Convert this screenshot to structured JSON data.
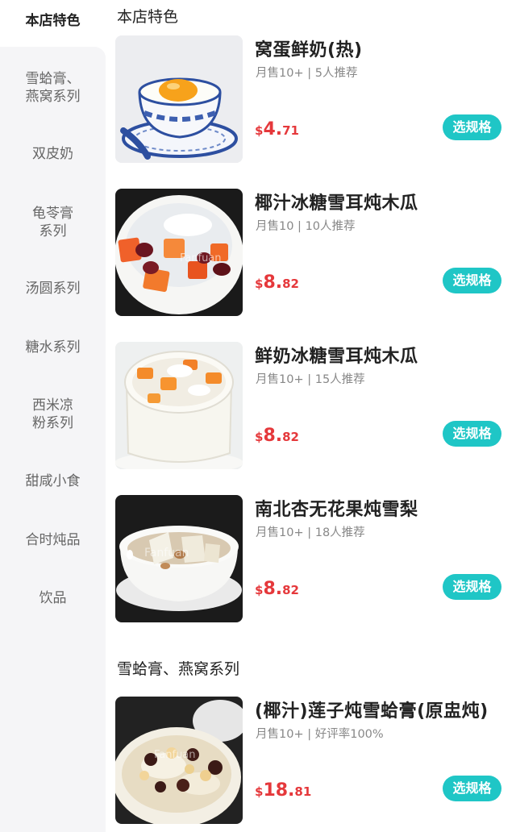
{
  "sidebar": {
    "items": [
      {
        "label": "本店特色"
      },
      {
        "label": "雪蛤膏、\n燕窝系列"
      },
      {
        "label": "双皮奶"
      },
      {
        "label": "龟苓膏\n系列"
      },
      {
        "label": "汤圆系列"
      },
      {
        "label": "糖水系列"
      },
      {
        "label": "西米凉\n粉系列"
      },
      {
        "label": "甜咸小食"
      },
      {
        "label": "合时炖品"
      },
      {
        "label": "饮品"
      }
    ]
  },
  "sections": [
    {
      "title": "本店特色"
    },
    {
      "title": "雪蛤膏、燕窝系列"
    }
  ],
  "products": [
    {
      "name": "窝蛋鲜奶(热)",
      "sales": "月售10+",
      "recommend": "5人推荐",
      "currency": "$",
      "price_int": "4.",
      "price_dec": "71",
      "button": "选规格"
    },
    {
      "name": "椰汁冰糖雪耳炖木瓜",
      "sales": "月售10",
      "recommend": "10人推荐",
      "currency": "$",
      "price_int": "8.",
      "price_dec": "82",
      "button": "选规格"
    },
    {
      "name": "鲜奶冰糖雪耳炖木瓜",
      "sales": "月售10+",
      "recommend": "15人推荐",
      "currency": "$",
      "price_int": "8.",
      "price_dec": "82",
      "button": "选规格"
    },
    {
      "name": "南北杏无花果炖雪梨",
      "sales": "月售10+",
      "recommend": "18人推荐",
      "currency": "$",
      "price_int": "8.",
      "price_dec": "82",
      "button": "选规格"
    },
    {
      "name": "(椰汁)莲子炖雪蛤膏(原盅炖)",
      "sales": "月售10+",
      "recommend": "好评率100%",
      "currency": "$",
      "price_int": "18.",
      "price_dec": "81",
      "button": "选规格"
    }
  ],
  "separator": " | ",
  "watermark": "Fanfuan",
  "colors": {
    "accent": "#1fc6c6",
    "price": "#e5383b",
    "sidebar_bg": "#f5f5f7"
  }
}
